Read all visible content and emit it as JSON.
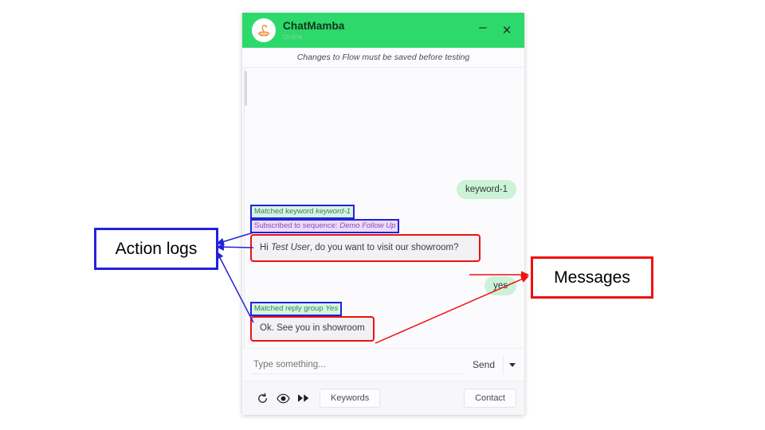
{
  "widget": {
    "header": {
      "title": "ChatMamba",
      "status": "Online",
      "logo_icon": "snake-logo-icon",
      "minimize_label": "–",
      "close_label": "×"
    },
    "notice": "Changes to Flow must be saved before testing",
    "conversation": [
      {
        "id": "msg-keyword-1",
        "kind": "user-bubble",
        "align": "right",
        "text": "keyword-1",
        "color": "#ccf2d8"
      },
      {
        "id": "log-matched-keyword",
        "kind": "action-log",
        "align": "left",
        "prefix": "Matched keyword ",
        "emphasis": "keyword-1",
        "color": "#3b7f57",
        "background": "#d6f5e1",
        "highlight": "blue"
      },
      {
        "id": "log-subscribed",
        "kind": "action-log",
        "align": "left",
        "prefix": "Subscribed to sequence: ",
        "emphasis": "Demo Follow Up",
        "color": "#8b4bbf",
        "background": "#ecdcf5",
        "highlight": "blue"
      },
      {
        "id": "msg-bot-showroom",
        "kind": "bot-bubble",
        "align": "left",
        "prefix": "Hi ",
        "emphasis": "Test User",
        "suffix": ", do you want to visit our showroom?",
        "color": "#f2f2f5",
        "highlight": "red"
      },
      {
        "id": "msg-yes",
        "kind": "user-bubble",
        "align": "right",
        "text": "yes",
        "color": "#ccf2d8"
      },
      {
        "id": "log-matched-reply",
        "kind": "action-log",
        "align": "left",
        "prefix": "Matched reply group ",
        "emphasis": "Yes",
        "color": "#3b7f57",
        "background": "#d6f5e1",
        "highlight": "blue"
      },
      {
        "id": "msg-bot-ok",
        "kind": "bot-bubble",
        "align": "left",
        "text": "Ok. See you in showroom",
        "color": "#f2f2f5",
        "highlight": "red"
      }
    ],
    "composer": {
      "placeholder": "Type something...",
      "value": "",
      "send_label": "Send",
      "caret_icon": "chevron-down-icon"
    },
    "toolbar": {
      "refresh_icon": "refresh-icon",
      "eye_icon": "eye-icon",
      "forward_icon": "fast-forward-icon",
      "keywords_label": "Keywords",
      "contact_label": "Contact"
    }
  },
  "annotations": {
    "action_logs": {
      "label": "Action logs",
      "color": "#2222dd"
    },
    "messages": {
      "label": "Messages",
      "color": "#ee1111"
    }
  }
}
